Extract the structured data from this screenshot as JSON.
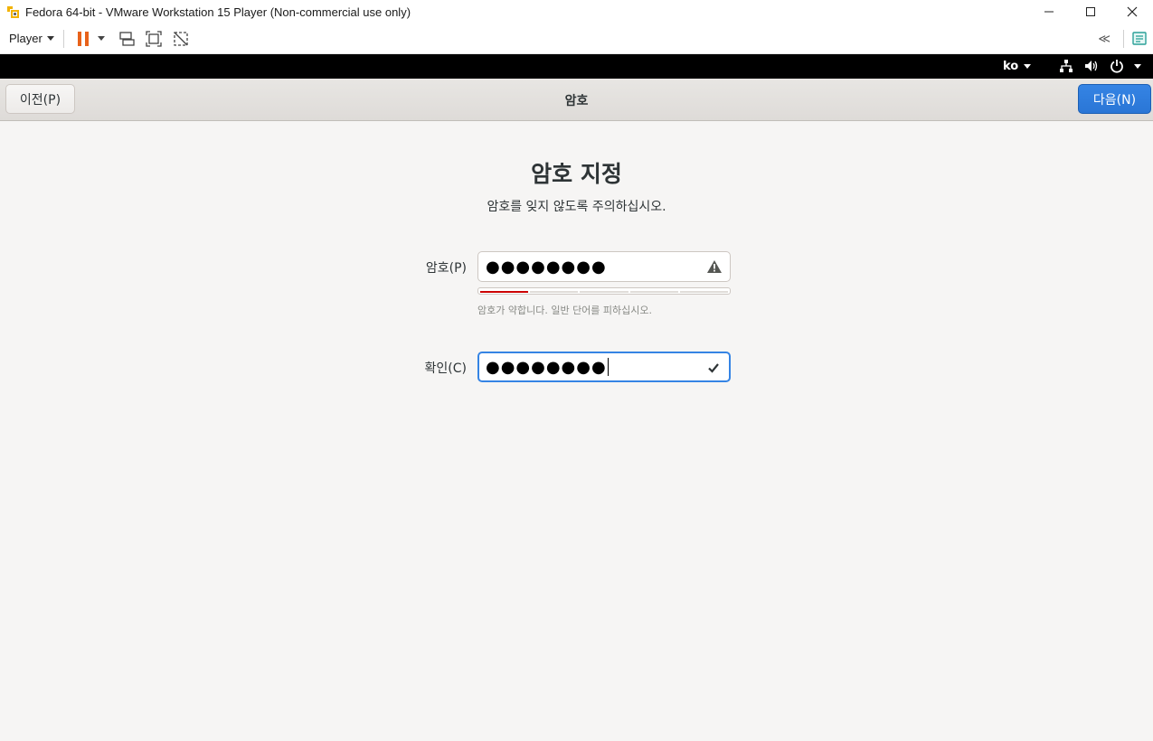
{
  "window": {
    "title": "Fedora 64-bit - VMware Workstation 15 Player (Non-commercial use only)"
  },
  "toolbar": {
    "player_label": "Player",
    "back_glyph": "≪"
  },
  "gnome_bar": {
    "language": "ko"
  },
  "headerbar": {
    "back_label": "이전(P)",
    "title": "암호",
    "next_label": "다음(N)"
  },
  "page": {
    "heading": "암호 지정",
    "subheading": "암호를 잊지 않도록 주의하십시오."
  },
  "password": {
    "label": "암호(P)",
    "masked_value": "●●●●●●●●",
    "status_icon": "warning-icon",
    "strength": 0.2,
    "hint": "암호가 약합니다. 일반 단어를 피하십시오."
  },
  "confirm": {
    "label": "확인(C)",
    "masked_value": "●●●●●●●●",
    "status_icon": "check-icon"
  },
  "colors": {
    "accent": "#3584e4",
    "weak": "#cc0000",
    "pause": "#e8621a"
  }
}
